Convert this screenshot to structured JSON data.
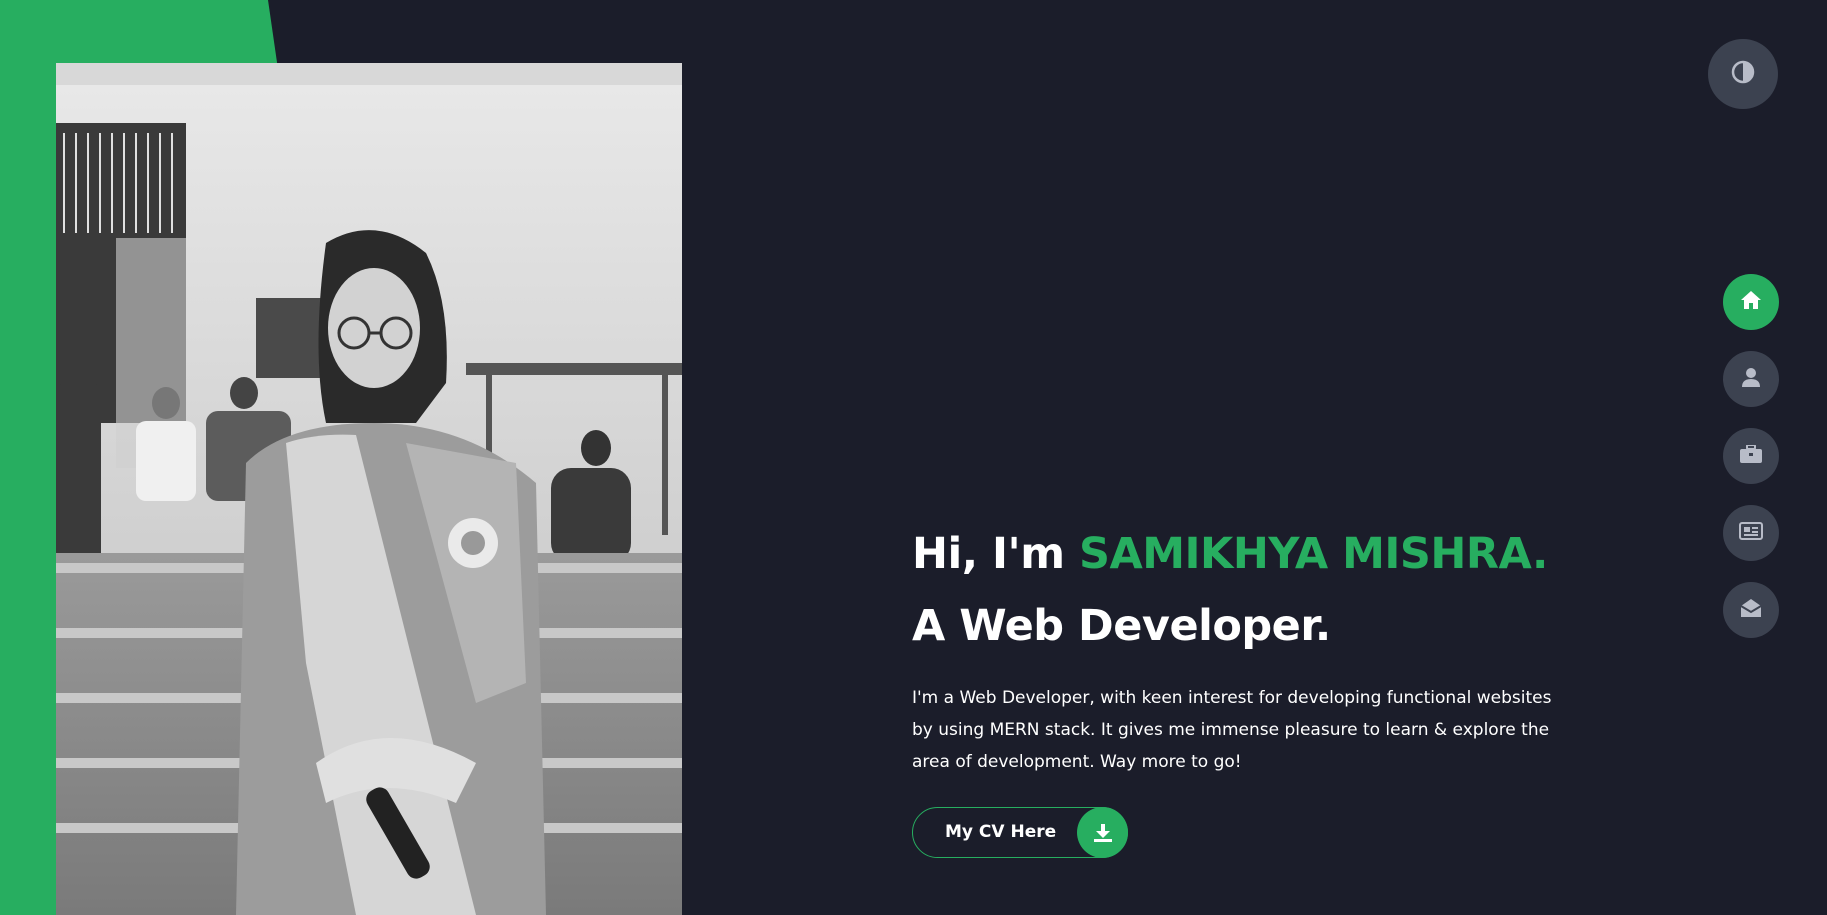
{
  "colors": {
    "background": "#1b1d2a",
    "accent": "#27ae60",
    "button_gray": "#3c4250",
    "icon_gray": "#b8bcc8",
    "text": "#ffffff"
  },
  "theme_toggle": {
    "icon": "half-circle-contrast-icon"
  },
  "nav": {
    "items": [
      {
        "icon": "home-icon",
        "active": true
      },
      {
        "icon": "user-icon",
        "active": false
      },
      {
        "icon": "briefcase-icon",
        "active": false
      },
      {
        "icon": "newspaper-icon",
        "active": false
      },
      {
        "icon": "envelope-open-icon",
        "active": false
      }
    ]
  },
  "hero": {
    "greeting": "Hi, I'm ",
    "name": "SAMIKHYA MISHRA.",
    "role": "A Web Developer.",
    "description": "I'm a Web Developer, with keen interest for developing functional websites by using MERN stack. It gives me immense pleasure to learn & explore the area of development. Way more to go!",
    "cv_button": {
      "label": "My CV Here",
      "icon": "download-icon"
    }
  },
  "photo": {
    "icon": "profile-photo"
  }
}
